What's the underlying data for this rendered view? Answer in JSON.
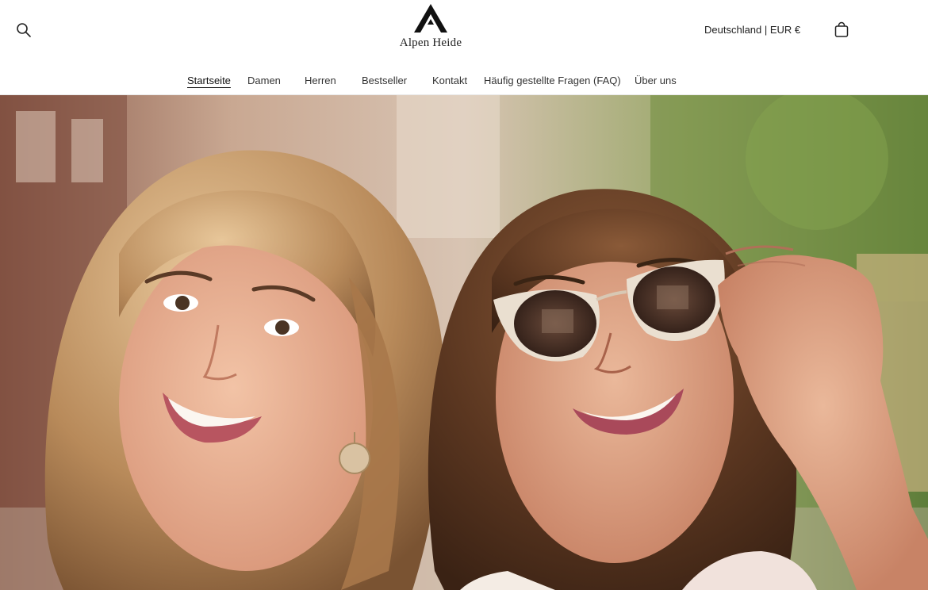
{
  "brand": {
    "name": "Alpen Heide",
    "color": "#111111"
  },
  "header": {
    "search_icon": "search-icon",
    "cart_icon": "shopping-bag-icon",
    "locale": "Deutschland | EUR €"
  },
  "nav": {
    "items": [
      {
        "label": "Startseite",
        "active": true
      },
      {
        "label": "Damen",
        "active": false
      },
      {
        "label": "Herren",
        "active": false
      },
      {
        "label": "Bestseller",
        "active": false
      },
      {
        "label": "Kontakt",
        "active": false
      },
      {
        "label": "Häufig gestellte Fragen (FAQ)",
        "active": false
      },
      {
        "label": "Über uns",
        "active": false
      }
    ]
  },
  "hero": {
    "image": "two-smiling-women-with-sunglasses-photo"
  }
}
